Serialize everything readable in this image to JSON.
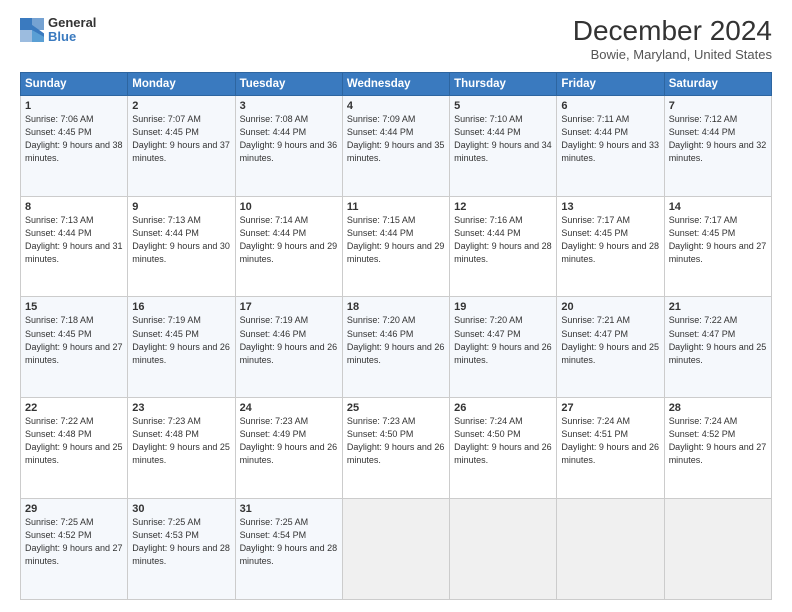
{
  "logo": {
    "general": "General",
    "blue": "Blue"
  },
  "title": "December 2024",
  "subtitle": "Bowie, Maryland, United States",
  "days_header": [
    "Sunday",
    "Monday",
    "Tuesday",
    "Wednesday",
    "Thursday",
    "Friday",
    "Saturday"
  ],
  "weeks": [
    [
      {
        "num": "1",
        "sunrise": "7:06 AM",
        "sunset": "4:45 PM",
        "daylight": "9 hours and 38 minutes."
      },
      {
        "num": "2",
        "sunrise": "7:07 AM",
        "sunset": "4:45 PM",
        "daylight": "9 hours and 37 minutes."
      },
      {
        "num": "3",
        "sunrise": "7:08 AM",
        "sunset": "4:44 PM",
        "daylight": "9 hours and 36 minutes."
      },
      {
        "num": "4",
        "sunrise": "7:09 AM",
        "sunset": "4:44 PM",
        "daylight": "9 hours and 35 minutes."
      },
      {
        "num": "5",
        "sunrise": "7:10 AM",
        "sunset": "4:44 PM",
        "daylight": "9 hours and 34 minutes."
      },
      {
        "num": "6",
        "sunrise": "7:11 AM",
        "sunset": "4:44 PM",
        "daylight": "9 hours and 33 minutes."
      },
      {
        "num": "7",
        "sunrise": "7:12 AM",
        "sunset": "4:44 PM",
        "daylight": "9 hours and 32 minutes."
      }
    ],
    [
      {
        "num": "8",
        "sunrise": "7:13 AM",
        "sunset": "4:44 PM",
        "daylight": "9 hours and 31 minutes."
      },
      {
        "num": "9",
        "sunrise": "7:13 AM",
        "sunset": "4:44 PM",
        "daylight": "9 hours and 30 minutes."
      },
      {
        "num": "10",
        "sunrise": "7:14 AM",
        "sunset": "4:44 PM",
        "daylight": "9 hours and 29 minutes."
      },
      {
        "num": "11",
        "sunrise": "7:15 AM",
        "sunset": "4:44 PM",
        "daylight": "9 hours and 29 minutes."
      },
      {
        "num": "12",
        "sunrise": "7:16 AM",
        "sunset": "4:44 PM",
        "daylight": "9 hours and 28 minutes."
      },
      {
        "num": "13",
        "sunrise": "7:17 AM",
        "sunset": "4:45 PM",
        "daylight": "9 hours and 28 minutes."
      },
      {
        "num": "14",
        "sunrise": "7:17 AM",
        "sunset": "4:45 PM",
        "daylight": "9 hours and 27 minutes."
      }
    ],
    [
      {
        "num": "15",
        "sunrise": "7:18 AM",
        "sunset": "4:45 PM",
        "daylight": "9 hours and 27 minutes."
      },
      {
        "num": "16",
        "sunrise": "7:19 AM",
        "sunset": "4:45 PM",
        "daylight": "9 hours and 26 minutes."
      },
      {
        "num": "17",
        "sunrise": "7:19 AM",
        "sunset": "4:46 PM",
        "daylight": "9 hours and 26 minutes."
      },
      {
        "num": "18",
        "sunrise": "7:20 AM",
        "sunset": "4:46 PM",
        "daylight": "9 hours and 26 minutes."
      },
      {
        "num": "19",
        "sunrise": "7:20 AM",
        "sunset": "4:47 PM",
        "daylight": "9 hours and 26 minutes."
      },
      {
        "num": "20",
        "sunrise": "7:21 AM",
        "sunset": "4:47 PM",
        "daylight": "9 hours and 25 minutes."
      },
      {
        "num": "21",
        "sunrise": "7:22 AM",
        "sunset": "4:47 PM",
        "daylight": "9 hours and 25 minutes."
      }
    ],
    [
      {
        "num": "22",
        "sunrise": "7:22 AM",
        "sunset": "4:48 PM",
        "daylight": "9 hours and 25 minutes."
      },
      {
        "num": "23",
        "sunrise": "7:23 AM",
        "sunset": "4:48 PM",
        "daylight": "9 hours and 25 minutes."
      },
      {
        "num": "24",
        "sunrise": "7:23 AM",
        "sunset": "4:49 PM",
        "daylight": "9 hours and 26 minutes."
      },
      {
        "num": "25",
        "sunrise": "7:23 AM",
        "sunset": "4:50 PM",
        "daylight": "9 hours and 26 minutes."
      },
      {
        "num": "26",
        "sunrise": "7:24 AM",
        "sunset": "4:50 PM",
        "daylight": "9 hours and 26 minutes."
      },
      {
        "num": "27",
        "sunrise": "7:24 AM",
        "sunset": "4:51 PM",
        "daylight": "9 hours and 26 minutes."
      },
      {
        "num": "28",
        "sunrise": "7:24 AM",
        "sunset": "4:52 PM",
        "daylight": "9 hours and 27 minutes."
      }
    ],
    [
      {
        "num": "29",
        "sunrise": "7:25 AM",
        "sunset": "4:52 PM",
        "daylight": "9 hours and 27 minutes."
      },
      {
        "num": "30",
        "sunrise": "7:25 AM",
        "sunset": "4:53 PM",
        "daylight": "9 hours and 28 minutes."
      },
      {
        "num": "31",
        "sunrise": "7:25 AM",
        "sunset": "4:54 PM",
        "daylight": "9 hours and 28 minutes."
      },
      null,
      null,
      null,
      null
    ]
  ]
}
